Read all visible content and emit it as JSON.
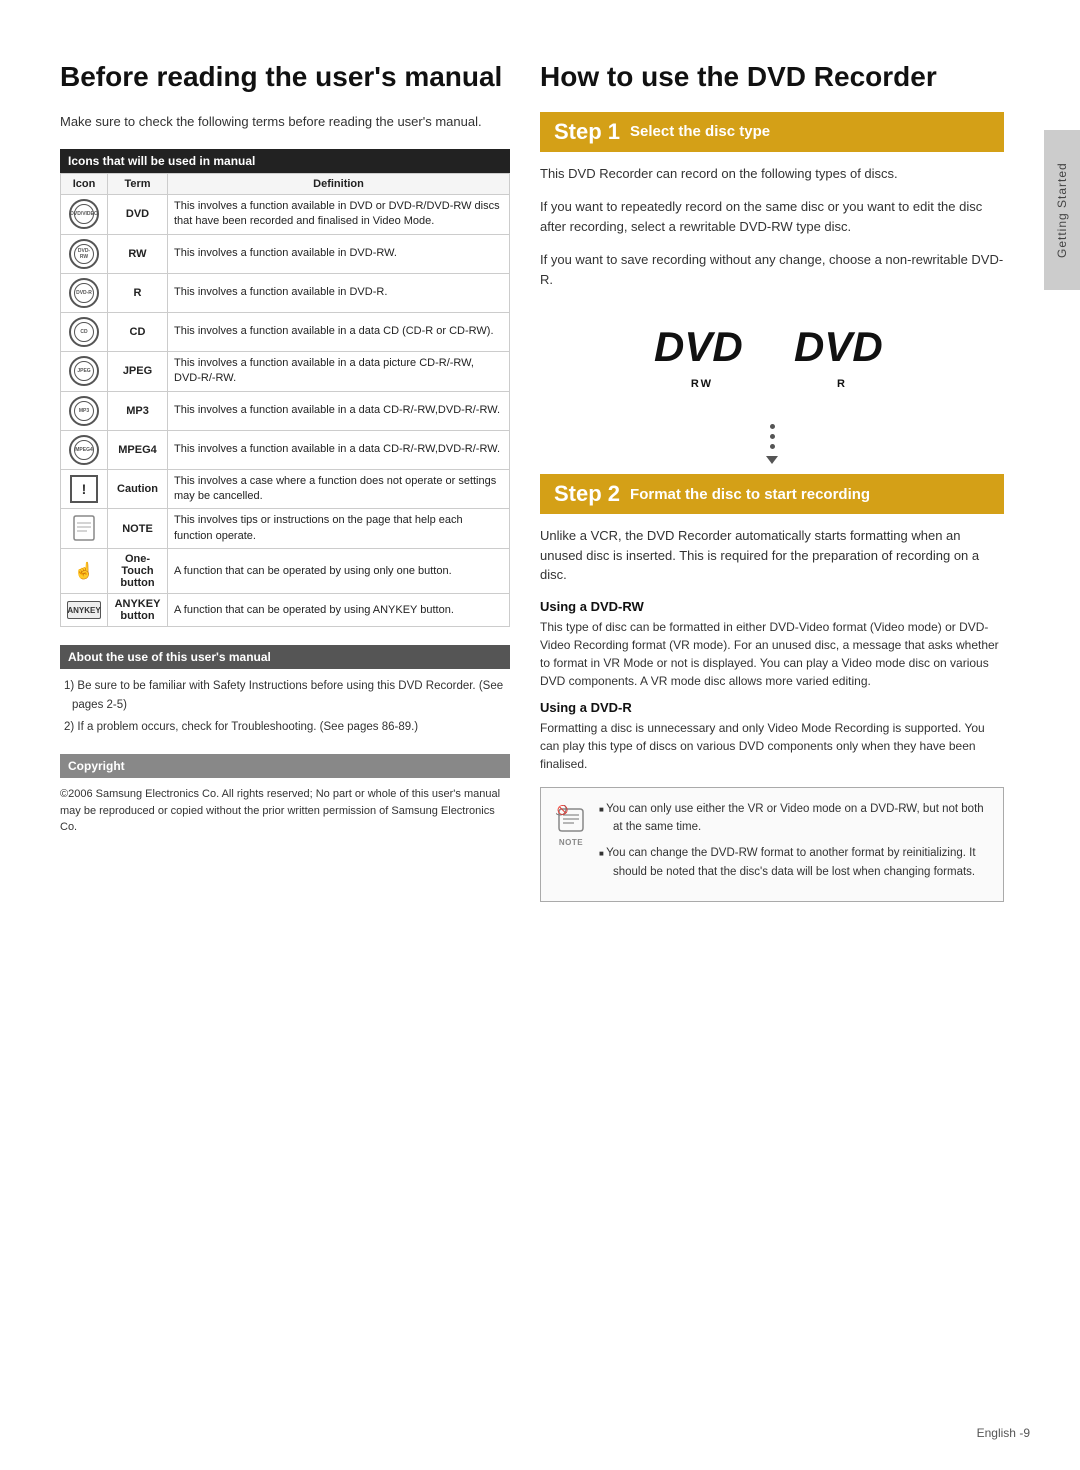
{
  "left": {
    "title": "Before reading the user's manual",
    "intro": "Make sure to check the following terms before reading the user's manual.",
    "icons_table": {
      "header": "Icons that will be used in manual",
      "columns": [
        "Icon",
        "Term",
        "Definition"
      ],
      "rows": [
        {
          "icon_type": "circle",
          "icon_label": "DVD/VIDEO",
          "term": "DVD",
          "definition": "This involves a function available in DVD or DVD-R/DVD-RW discs that have been recorded and finalised in Video Mode."
        },
        {
          "icon_type": "circle",
          "icon_label": "DVD-RW",
          "term": "RW",
          "definition": "This involves a function available in DVD-RW."
        },
        {
          "icon_type": "circle",
          "icon_label": "DVD-R",
          "term": "R",
          "definition": "This involves a function available in DVD-R."
        },
        {
          "icon_type": "circle",
          "icon_label": "CD",
          "term": "CD",
          "definition": "This involves a function available in a data CD (CD-R or CD-RW)."
        },
        {
          "icon_type": "circle",
          "icon_label": "JPEG",
          "term": "JPEG",
          "definition": "This involves a function available in a data picture CD-R/-RW, DVD-R/-RW."
        },
        {
          "icon_type": "circle",
          "icon_label": "MP3",
          "term": "MP3",
          "definition": "This involves a function available in a data CD-R/-RW,DVD-R/-RW."
        },
        {
          "icon_type": "circle",
          "icon_label": "MPEG4",
          "term": "MPEG4",
          "definition": "This involves a function available in a data CD-R/-RW,DVD-R/-RW."
        },
        {
          "icon_type": "exclaim",
          "icon_label": "!",
          "term": "Caution",
          "definition": "This involves a case where a function does not operate or settings may be cancelled."
        },
        {
          "icon_type": "note",
          "icon_label": "NOTE",
          "term": "NOTE",
          "definition": "This involves tips or instructions on the page that help each function operate."
        },
        {
          "icon_type": "hand",
          "icon_label": "One-Touch",
          "term": "One-Touch button",
          "definition": "A function that can be operated by using only one button."
        },
        {
          "icon_type": "anykey",
          "icon_label": "ANYKEY",
          "term": "ANYKEY button",
          "definition": "A function that can be operated by using ANYKEY button."
        }
      ]
    },
    "about_section": {
      "header": "About the use of this user's manual",
      "items": [
        "1) Be sure to be familiar with Safety Instructions before using this DVD Recorder. (See pages 2-5)",
        "2) If a problem occurs, check for Troubleshooting. (See pages 86-89.)"
      ]
    },
    "copyright": {
      "header": "Copyright",
      "text": "©2006 Samsung Electronics Co.\nAll rights reserved; No part or whole of this user's manual may be reproduced or copied without the prior written permission of Samsung Electronics Co."
    }
  },
  "right": {
    "title": "How to use the DVD Recorder",
    "step1": {
      "number": "Step 1",
      "label": "Select the disc type",
      "description1": "This DVD Recorder can record on the following types of discs.",
      "description2": "If you want to repeatedly record on the same disc or you want to edit the disc after recording, select a rewritable DVD-RW type disc.",
      "description3": "If you want to save recording without any change, choose a non-rewritable DVD-R.",
      "disc_rw": "RW",
      "disc_r": "R",
      "dvd_label": "DVD"
    },
    "step2": {
      "number": "Step 2",
      "label": "Format the disc to start recording",
      "description": "Unlike a VCR, the DVD Recorder automatically starts formatting when an unused disc is inserted. This is required for the preparation of recording on a disc.",
      "using_dvdrw_header": "Using a DVD-RW",
      "using_dvdrw_text": "This type of disc can be formatted in either DVD-Video format (Video mode) or DVD-Video Recording format (VR mode). For an unused disc, a message that asks whether to format in VR Mode or not is displayed. You can play a Video mode disc on various DVD components. A VR mode disc allows more varied editing.",
      "using_dvdr_header": "Using a DVD-R",
      "using_dvdr_text": "Formatting a disc is unnecessary and only Video Mode Recording is supported. You can play this type of discs on various DVD components only when they have been finalised.",
      "note_items": [
        "You can only use either the VR or Video mode on a DVD-RW, but not both at the same time.",
        "You can change the DVD-RW format to another format by reinitializing. It should be noted that the disc's data will be lost when changing formats."
      ]
    }
  },
  "footer": {
    "page_info": "English -9"
  },
  "side_tab": {
    "label": "Getting Started"
  }
}
